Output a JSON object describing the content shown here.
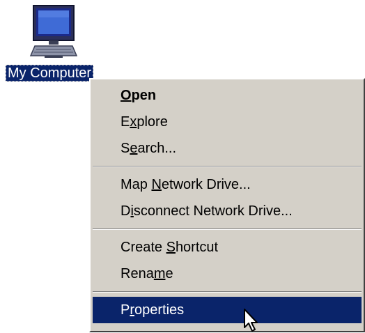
{
  "desktop": {
    "icon": {
      "name": "computer-icon",
      "label": "My Computer"
    }
  },
  "context_menu": {
    "items": [
      {
        "label": "Open",
        "mnemonic": "O",
        "bold": true
      },
      {
        "label": "Explore",
        "mnemonic": "x"
      },
      {
        "label": "Search...",
        "mnemonic": "e"
      },
      {
        "label": "Map Network Drive...",
        "mnemonic": "N"
      },
      {
        "label": "Disconnect Network Drive...",
        "mnemonic": "i"
      },
      {
        "label": "Create Shortcut",
        "mnemonic": "S"
      },
      {
        "label": "Rename",
        "mnemonic": "m"
      },
      {
        "label": "Properties",
        "mnemonic": "r",
        "highlighted": true
      }
    ]
  },
  "colors": {
    "selection": "#0a246a",
    "menu_face": "#d4d0c8"
  },
  "cursor": {
    "icon": "arrow-pointer-icon"
  }
}
